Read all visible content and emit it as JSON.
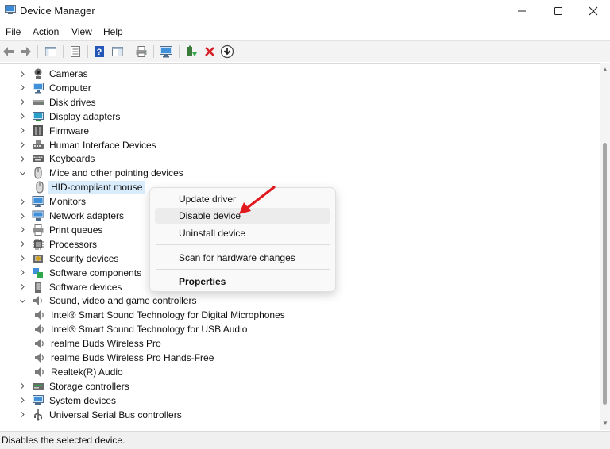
{
  "window": {
    "title": "Device Manager"
  },
  "menu": [
    "File",
    "Action",
    "View",
    "Help"
  ],
  "tree": [
    {
      "label": "Cameras",
      "icon": "camera-icon",
      "expanded": false,
      "depth": 0
    },
    {
      "label": "Computer",
      "icon": "computer-icon",
      "expanded": false,
      "depth": 0
    },
    {
      "label": "Disk drives",
      "icon": "disk-drive-icon",
      "expanded": false,
      "depth": 0
    },
    {
      "label": "Display adapters",
      "icon": "display-adapter-icon",
      "expanded": false,
      "depth": 0
    },
    {
      "label": "Firmware",
      "icon": "firmware-icon",
      "expanded": false,
      "depth": 0
    },
    {
      "label": "Human Interface Devices",
      "icon": "hid-icon",
      "expanded": false,
      "depth": 0
    },
    {
      "label": "Keyboards",
      "icon": "keyboard-icon",
      "expanded": false,
      "depth": 0
    },
    {
      "label": "Mice and other pointing devices",
      "icon": "mouse-icon",
      "expanded": true,
      "depth": 0
    },
    {
      "label": "HID-compliant mouse",
      "icon": "mouse-icon",
      "depth": 1,
      "selected": true
    },
    {
      "label": "Monitors",
      "icon": "monitor-icon",
      "expanded": false,
      "depth": 0
    },
    {
      "label": "Network adapters",
      "icon": "network-adapter-icon",
      "expanded": false,
      "depth": 0
    },
    {
      "label": "Print queues",
      "icon": "printer-icon",
      "expanded": false,
      "depth": 0
    },
    {
      "label": "Processors",
      "icon": "processor-icon",
      "expanded": false,
      "depth": 0
    },
    {
      "label": "Security devices",
      "icon": "security-device-icon",
      "expanded": false,
      "depth": 0
    },
    {
      "label": "Software components",
      "icon": "software-component-icon",
      "expanded": false,
      "depth": 0
    },
    {
      "label": "Software devices",
      "icon": "software-device-icon",
      "expanded": false,
      "depth": 0
    },
    {
      "label": "Sound, video and game controllers",
      "icon": "speaker-icon",
      "expanded": true,
      "depth": 0
    },
    {
      "label": "Intel® Smart Sound Technology for Digital Microphones",
      "icon": "speaker-icon",
      "depth": 1
    },
    {
      "label": "Intel® Smart Sound Technology for USB Audio",
      "icon": "speaker-icon",
      "depth": 1
    },
    {
      "label": "realme Buds Wireless Pro",
      "icon": "speaker-icon",
      "depth": 1
    },
    {
      "label": "realme Buds Wireless Pro Hands-Free",
      "icon": "speaker-icon",
      "depth": 1
    },
    {
      "label": "Realtek(R) Audio",
      "icon": "speaker-icon",
      "depth": 1
    },
    {
      "label": "Storage controllers",
      "icon": "storage-controller-icon",
      "expanded": false,
      "depth": 0
    },
    {
      "label": "System devices",
      "icon": "system-device-icon",
      "expanded": false,
      "depth": 0
    },
    {
      "label": "Universal Serial Bus controllers",
      "icon": "usb-controller-icon",
      "expanded": false,
      "depth": 0
    }
  ],
  "context_menu": {
    "items": [
      {
        "label": "Update driver"
      },
      {
        "label": "Disable device",
        "hovered": true
      },
      {
        "label": "Uninstall device"
      },
      {
        "label": "Scan for hardware changes"
      },
      {
        "label": "Properties",
        "bold": true
      }
    ]
  },
  "status": {
    "text": "Disables the selected device."
  },
  "colors": {
    "annotation_arrow": "#e0191f",
    "selection": "#d9ecfb",
    "uninstall_x": "#d61f26"
  }
}
